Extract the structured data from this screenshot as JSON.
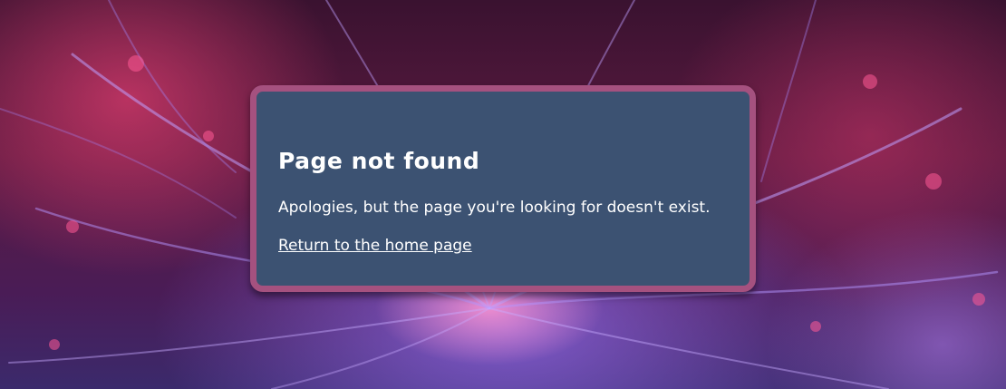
{
  "error_card": {
    "title": "Page not found",
    "message": "Apologies, but the page you're looking for doesn't exist.",
    "home_link": "Return to the home page"
  },
  "colors": {
    "card_background": "#3c5272",
    "card_border": "#a5517f",
    "text": "#ffffff"
  }
}
